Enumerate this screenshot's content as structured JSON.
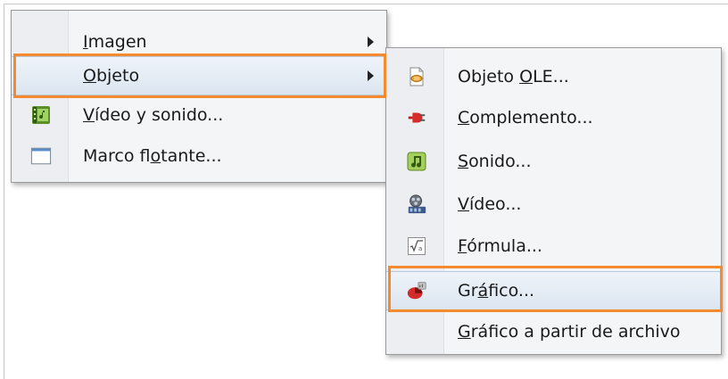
{
  "main_menu": {
    "items": [
      {
        "pre": "",
        "ul": "I",
        "post": "magen",
        "has_submenu": true
      },
      {
        "pre": "",
        "ul": "O",
        "post": "bjeto",
        "has_submenu": true
      },
      {
        "pre": "",
        "ul": "V",
        "post": "ídeo y sonido...",
        "icon": "film-sound-icon"
      },
      {
        "pre": "Marco fl",
        "ul": "o",
        "post": "tante...",
        "icon": "frame-window-icon"
      }
    ]
  },
  "sub_menu": {
    "items": [
      {
        "pre": "Objeto ",
        "ul": "O",
        "post": "LE...",
        "icon": "ole-object-icon"
      },
      {
        "pre": "",
        "ul": "C",
        "post": "omplemento...",
        "icon": "plugin-icon"
      },
      {
        "pre": "",
        "ul": "S",
        "post": "onido...",
        "icon": "music-note-icon"
      },
      {
        "pre": "",
        "ul": "V",
        "post": "ídeo...",
        "icon": "film-reel-icon"
      },
      {
        "pre": "",
        "ul": "F",
        "post": "órmula...",
        "icon": "formula-icon"
      },
      {
        "pre": "Gr",
        "ul": "á",
        "post": "fico...",
        "icon": "chart-icon"
      },
      {
        "pre": "",
        "ul": "G",
        "post": "ráfico a partir de archivo",
        "icon": ""
      }
    ]
  },
  "colors": {
    "highlight_outline": "#f58a2f",
    "hover_background": "#dce6f1"
  }
}
